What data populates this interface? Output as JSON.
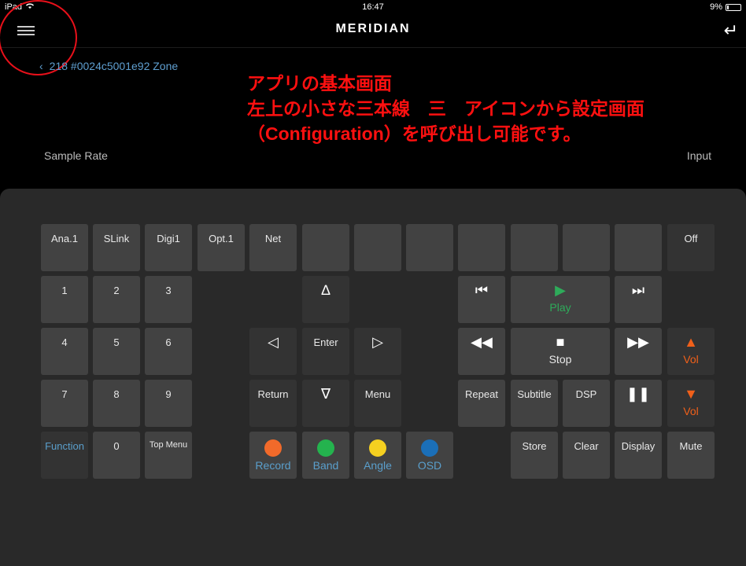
{
  "status": {
    "carrier": "iPad",
    "time": "16:47",
    "battery": "9%",
    "battery_level": 0.09
  },
  "header": {
    "brand": "MERIDIAN",
    "back_icon": "back-arrow-icon",
    "menu_icon": "hamburger-icon"
  },
  "zone": {
    "label": "218 #0024c5001e92 Zone"
  },
  "annotation": {
    "line1": "アプリの基本画面",
    "line2": "左上の小さな三本線　三　アイコンから設定画面",
    "line3": "（Configuration）を呼び出し可能です。"
  },
  "info": {
    "sample_rate": "Sample Rate",
    "input": "Input"
  },
  "row1": [
    "Ana.1",
    "SLink",
    "Digi1",
    "Opt.1",
    "Net",
    "",
    "",
    "",
    "",
    "",
    "",
    "",
    "Off"
  ],
  "numpad": [
    "1",
    "2",
    "3",
    "4",
    "5",
    "6",
    "7",
    "8",
    "9"
  ],
  "nav": {
    "enter": "Enter",
    "return": "Return",
    "menu": "Menu",
    "up": "∆",
    "down": "∇",
    "left": "◁",
    "right": "▷"
  },
  "bottom_left": {
    "function": "Function",
    "zero": "0",
    "top_menu": "Top Menu"
  },
  "colors": {
    "record": {
      "label": "Record",
      "color": "#f26a2a"
    },
    "band": {
      "label": "Band",
      "color": "#24b34e"
    },
    "angle": {
      "label": "Angle",
      "color": "#f5d020"
    },
    "osd": {
      "label": "OSD",
      "color": "#1b6fb8"
    }
  },
  "transport": {
    "prev": "⏮",
    "play_icon": "▶",
    "play": "Play",
    "next": "⏭",
    "rewind": "◀◀",
    "stop_icon": "■",
    "stop": "Stop",
    "ffwd": "▶▶",
    "vol_up_icon": "▲",
    "vol_up": "Vol",
    "vol_down_icon": "▼",
    "vol_down": "Vol",
    "repeat": "Repeat",
    "subtitle": "Subtitle",
    "dsp": "DSP",
    "pause": "❚❚",
    "store": "Store",
    "clear": "Clear",
    "display": "Display",
    "mute": "Mute"
  }
}
